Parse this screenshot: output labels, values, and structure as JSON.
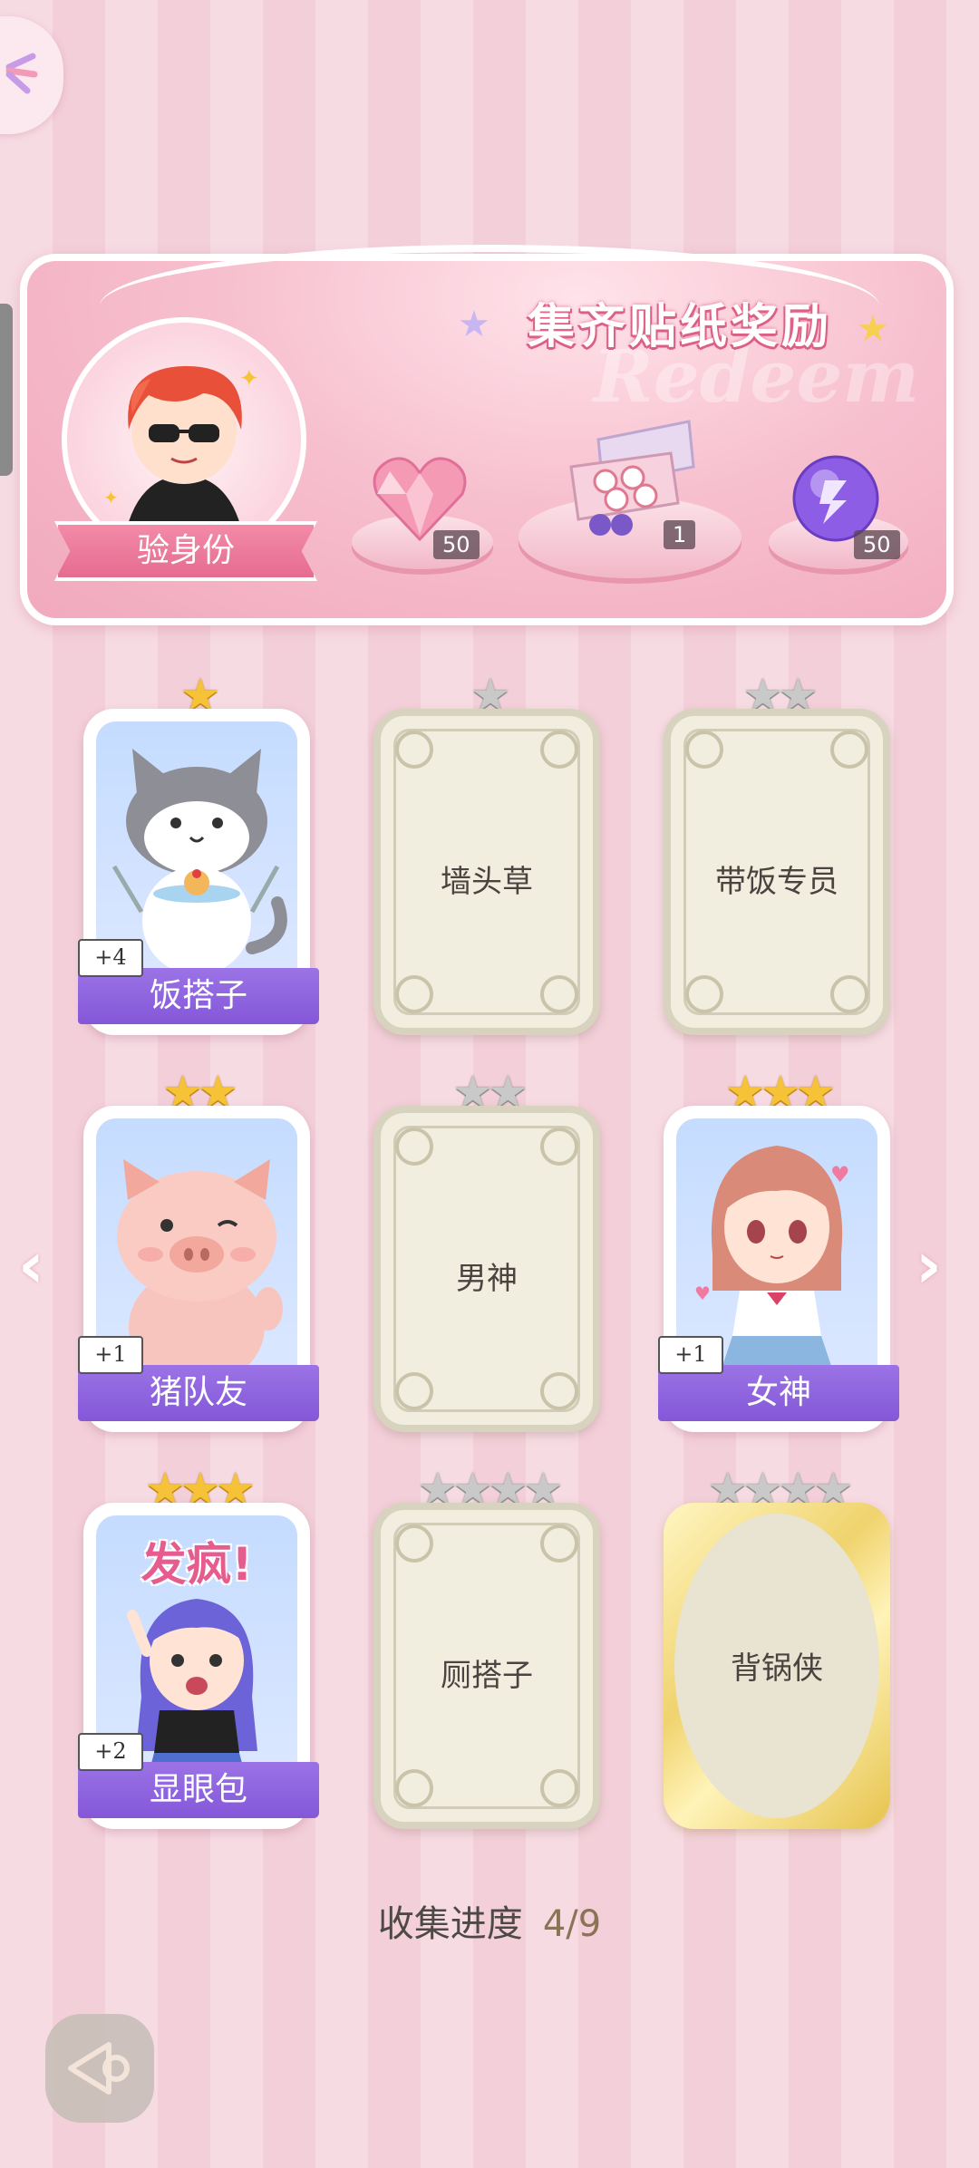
{
  "banner": {
    "title": "集齐贴纸奖励",
    "watermark": "Redeem",
    "identity_label": "验身份",
    "rewards": [
      {
        "icon": "pink-heart-gem-icon",
        "count": "50"
      },
      {
        "icon": "gift-box-icon",
        "count": "1"
      },
      {
        "icon": "purple-energy-orb-icon",
        "count": "50"
      }
    ]
  },
  "cards": [
    {
      "name": "饭搭子",
      "stars": 1,
      "owned": true,
      "extra": "+4",
      "art": "cat-eating-icon"
    },
    {
      "name": "墙头草",
      "stars": 1,
      "owned": false
    },
    {
      "name": "带饭专员",
      "stars": 2,
      "owned": false
    },
    {
      "name": "猪队友",
      "stars": 2,
      "owned": true,
      "extra": "+1",
      "art": "pig-winking-icon"
    },
    {
      "name": "男神",
      "stars": 2,
      "owned": false
    },
    {
      "name": "女神",
      "stars": 3,
      "owned": true,
      "extra": "+1",
      "art": "schoolgirl-icon"
    },
    {
      "name": "显眼包",
      "stars": 3,
      "owned": true,
      "extra": "+2",
      "art": "girl-shouting-icon",
      "art_text": "发疯!"
    },
    {
      "name": "厕搭子",
      "stars": 4,
      "owned": false
    },
    {
      "name": "背锅侠",
      "stars": 4,
      "owned": false,
      "gold": true
    }
  ],
  "progress": {
    "label": "收集进度",
    "value": "4/9"
  },
  "colors": {
    "gold_star": "#f6c338",
    "grey_star": "#c9c9c9",
    "purple_band": "#8a5ddc",
    "accent_pink": "#e56c91"
  }
}
